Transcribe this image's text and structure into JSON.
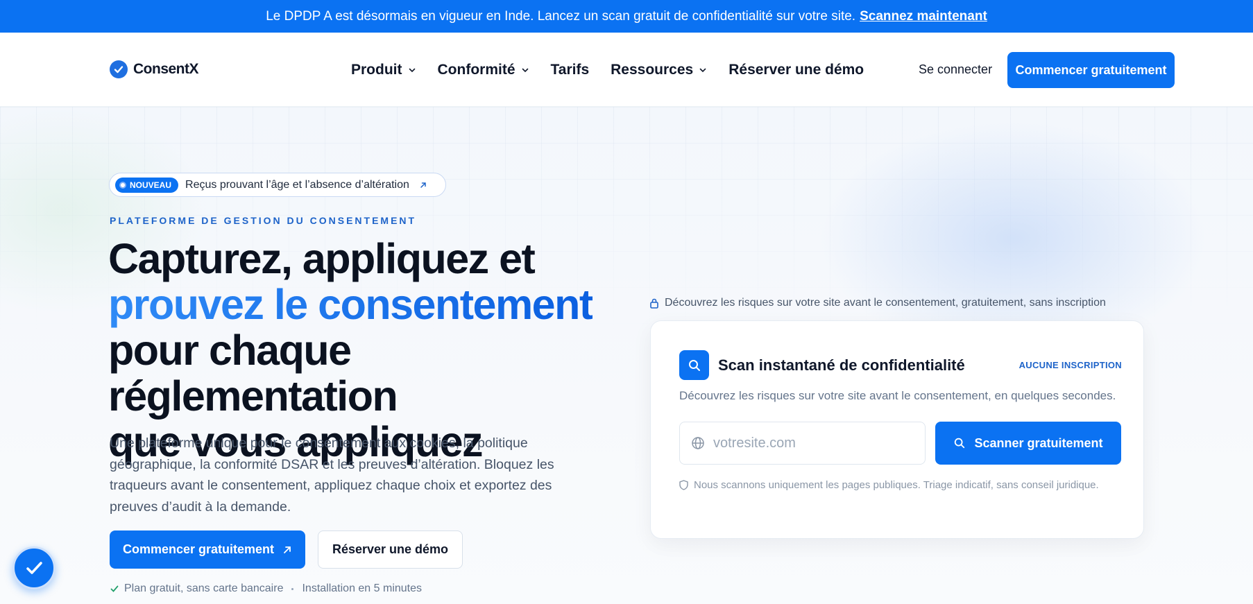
{
  "announcement": {
    "text": "Le DPDP A est désormais en vigueur en Inde. Lancez un scan gratuit de confidentialité sur votre site.",
    "cta": "Scannez maintenant"
  },
  "nav": {
    "logo": "ConsentX",
    "menu": [
      {
        "label": "Produit",
        "has_dropdown": true
      },
      {
        "label": "Conformité",
        "has_dropdown": true
      },
      {
        "label": "Tarifs",
        "has_dropdown": false
      },
      {
        "label": "Ressources",
        "has_dropdown": true
      },
      {
        "label": "Réserver une démo",
        "has_dropdown": false
      }
    ],
    "login": "Se connecter",
    "cta": "Commencer gratuitement"
  },
  "hero": {
    "badge_pill": "NOUVEAU",
    "badge_text": "Reçus prouvant l’âge et l’absence d’altération",
    "eyebrow": "PLATEFORME DE GESTION DU CONSENTEMENT",
    "title_line1": "Capturez, appliquez et",
    "title_accent": "prouvez le consentement",
    "title_line3": "pour chaque réglementation",
    "title_line4": "que vous appliquez",
    "lead": "Une plateforme unique pour le consentement aux cookies, la politique géographique, la conformité DSAR et les preuves d’altération. Bloquez les traqueurs avant le consentement, appliquez chaque choix et exportez des preuves d’audit à la demande.",
    "cta_primary": "Commencer gratuitement",
    "cta_secondary": "Réserver une démo",
    "perks": [
      "Plan gratuit, sans carte bancaire",
      "Installation en 5 minutes"
    ]
  },
  "scan": {
    "note": "Découvrez les risques sur votre site avant le consentement, gratuitement, sans inscription",
    "title": "Scan instantané de confidentialité",
    "tag": "AUCUNE INSCRIPTION",
    "subtitle": "Découvrez les risques sur votre site avant le consentement, en quelques secondes.",
    "input_placeholder": "votresite.com",
    "input_value": "",
    "button": "Scanner gratuitement",
    "footnote": "Nous scannons uniquement les pages publiques. Triage indicatif, sans conseil juridique."
  },
  "colors": {
    "brand": "#0b72f2",
    "accent_text": "#1d63c9",
    "heading": "#0b1220"
  }
}
